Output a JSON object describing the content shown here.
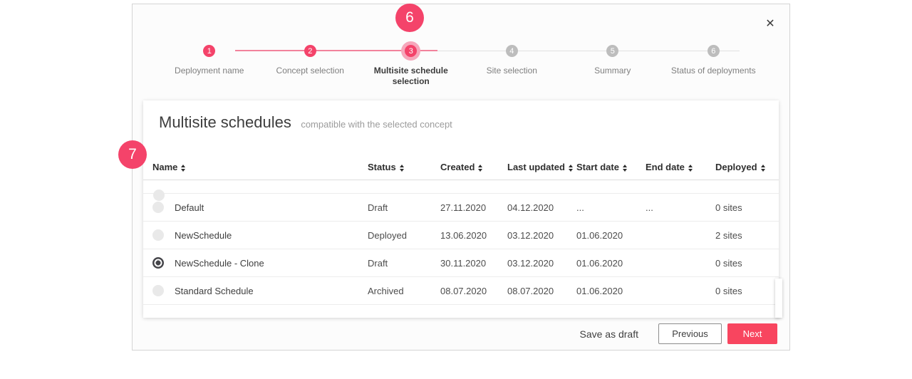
{
  "colors": {
    "accent": "#F4436A",
    "accent_halo": "#F6A7BB",
    "step_inactive": "#BDBDBD",
    "next_button": "#F8455F"
  },
  "modal": {
    "close_icon": "✕"
  },
  "annotations": {
    "step_badge": "6",
    "table_badge": "7"
  },
  "stepper": {
    "steps": [
      {
        "number": "1",
        "label": "Deployment name",
        "state": "done"
      },
      {
        "number": "2",
        "label": "Concept selection",
        "state": "done"
      },
      {
        "number": "3",
        "label": "Multisite schedule selection",
        "state": "active"
      },
      {
        "number": "4",
        "label": "Site selection",
        "state": "upcoming"
      },
      {
        "number": "5",
        "label": "Summary",
        "state": "upcoming"
      },
      {
        "number": "6",
        "label": "Status of deployments",
        "state": "upcoming"
      }
    ]
  },
  "table": {
    "title": "Multisite schedules",
    "subtitle": "compatible with the selected concept",
    "columns": [
      "Name",
      "Status",
      "Created",
      "Last updated",
      "Start date",
      "End date",
      "Deployed"
    ],
    "rows": [
      {
        "name": "Default",
        "status": "Draft",
        "created": "27.11.2020",
        "last_updated": "04.12.2020",
        "start_date": "...",
        "end_date": "...",
        "deployed": "0 sites",
        "selected": false
      },
      {
        "name": "NewSchedule",
        "status": "Deployed",
        "created": "13.06.2020",
        "last_updated": "03.12.2020",
        "start_date": "01.06.2020",
        "end_date": "",
        "deployed": "2 sites",
        "selected": false
      },
      {
        "name": "NewSchedule - Clone",
        "status": "Draft",
        "created": "30.11.2020",
        "last_updated": "03.12.2020",
        "start_date": "01.06.2020",
        "end_date": "",
        "deployed": "0 sites",
        "selected": true
      },
      {
        "name": "Standard Schedule",
        "status": "Archived",
        "created": "08.07.2020",
        "last_updated": "08.07.2020",
        "start_date": "01.06.2020",
        "end_date": "",
        "deployed": "0 sites",
        "selected": false
      }
    ]
  },
  "footer": {
    "save_as_draft": "Save as draft",
    "previous": "Previous",
    "next": "Next"
  }
}
